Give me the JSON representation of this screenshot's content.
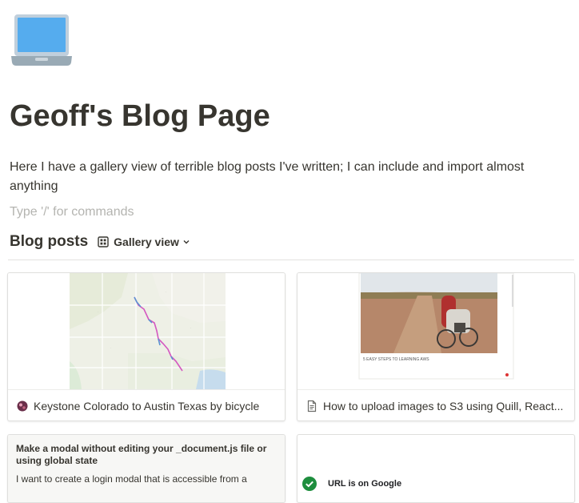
{
  "page": {
    "icon": "laptop-icon",
    "title": "Geoff's Blog Page",
    "intro": "Here I have a gallery view of terrible blog posts I've written; I can include and import almost anything",
    "command_placeholder": "Type '/' for commands"
  },
  "database": {
    "title": "Blog posts",
    "view_icon": "gallery-grid-icon",
    "view_label": "Gallery view"
  },
  "cards": [
    {
      "title": "Keystone Colorado to Austin Texas by bicycle",
      "icon": "page-emoji-icon",
      "media": "map-route-image"
    },
    {
      "title": "How to upload images to S3 using Quill, React...",
      "icon": "document-icon",
      "media": "gravel-road-bike-photo",
      "caption": "5 EASY STEPS TO LEARNING AWS"
    },
    {
      "title": "",
      "preview_heading": "Make a modal without editing your _document.js file or using global state",
      "preview_text": "I want to create a login modal that is accessible from a"
    },
    {
      "title": "",
      "preview_status": "URL is on Google",
      "status_icon": "check-circle-icon"
    }
  ],
  "colors": {
    "text": "#37352f",
    "muted": "#b4b4b0",
    "border": "#dfdfdd",
    "route": "#d457c0",
    "check": "#1e8e3e"
  }
}
